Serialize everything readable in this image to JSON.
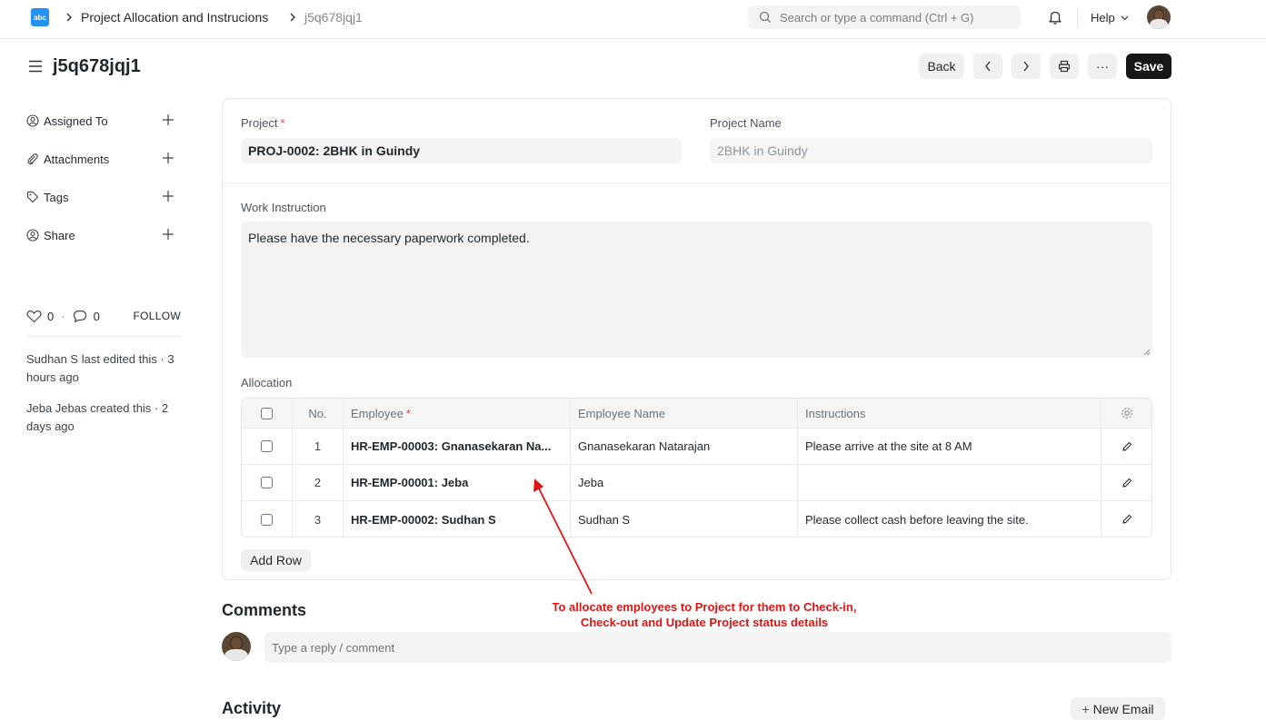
{
  "nav": {
    "logo_text": "abc",
    "breadcrumbs": [
      "Project Allocation and Instrucions",
      "j5q678jqj1"
    ],
    "search_placeholder": "Search or type a command (Ctrl + G)",
    "help_label": "Help"
  },
  "page": {
    "title": "j5q678jqj1",
    "back_label": "Back",
    "save_label": "Save",
    "more_label": "···"
  },
  "sidebar": {
    "items": [
      {
        "label": "Assigned To",
        "icon": "user-circle-icon"
      },
      {
        "label": "Attachments",
        "icon": "paperclip-icon"
      },
      {
        "label": "Tags",
        "icon": "tag-icon"
      },
      {
        "label": "Share",
        "icon": "share-user-icon"
      }
    ],
    "likes": "0",
    "separator": "·",
    "comments": "0",
    "follow_label": "FOLLOW",
    "log": [
      "Sudhan S last edited this · 3 hours ago",
      "Jeba Jebas created this · 2 days ago"
    ]
  },
  "form": {
    "project_label": "Project",
    "project_value": "PROJ-0002: 2BHK in Guindy",
    "project_name_label": "Project Name",
    "project_name_value": "2BHK in Guindy",
    "work_instruction_label": "Work Instruction",
    "work_instruction_value": "Please have the necessary paperwork completed.",
    "allocation_label": "Allocation",
    "required_marker": "*"
  },
  "table": {
    "headers": {
      "no": "No.",
      "employee": "Employee",
      "employee_name": "Employee Name",
      "instructions": "Instructions"
    },
    "rows": [
      {
        "no": "1",
        "employee": "HR-EMP-00003: Gnanasekaran Na...",
        "employee_name": "Gnanasekaran Natarajan",
        "instructions": "Please arrive at the site at 8 AM"
      },
      {
        "no": "2",
        "employee": "HR-EMP-00001: Jeba",
        "employee_name": "Jeba",
        "instructions": ""
      },
      {
        "no": "3",
        "employee": "HR-EMP-00002: Sudhan S",
        "employee_name": "Sudhan S",
        "instructions": "Please collect cash before leaving the site."
      }
    ],
    "add_row_label": "Add Row"
  },
  "annotation": {
    "line1": "To allocate employees to Project for them to Check-in,",
    "line2": "Check-out and Update Project status details",
    "color": "#e01313"
  },
  "comments": {
    "title": "Comments",
    "placeholder": "Type a reply / comment"
  },
  "activity": {
    "title": "Activity",
    "new_email_label": "New Email",
    "plus_symbol": "+"
  }
}
